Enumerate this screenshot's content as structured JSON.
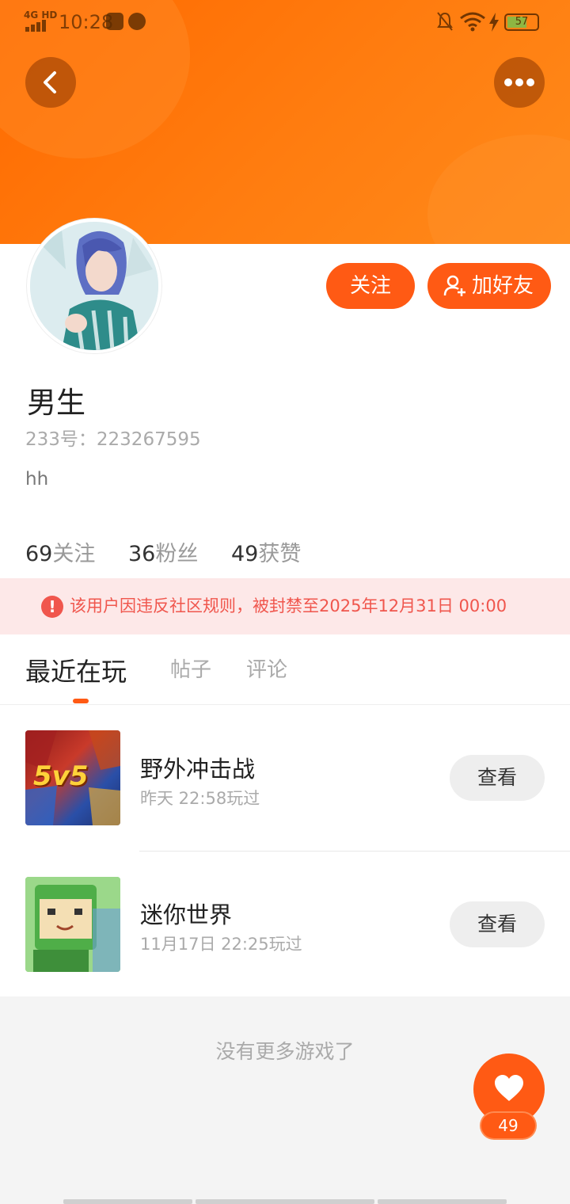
{
  "status_bar": {
    "network": "4G HD",
    "time": "10:28",
    "battery": "57"
  },
  "profile": {
    "name": "男生",
    "uid_label": "233号：",
    "uid": "223267595",
    "bio": "hh",
    "follow_label": "关注",
    "add_friend_label": "加好友",
    "stats": [
      {
        "value": "69",
        "label": "关注"
      },
      {
        "value": "36",
        "label": "粉丝"
      },
      {
        "value": "49",
        "label": "获赞"
      }
    ]
  },
  "ban_notice": "该用户因违反社区规则，被封禁至2025年12月31日 00:00",
  "tabs": [
    {
      "label": "最近在玩",
      "active": true
    },
    {
      "label": "帖子",
      "active": false
    },
    {
      "label": "评论",
      "active": false
    }
  ],
  "games": [
    {
      "name": "野外冲击战",
      "time": "昨天 22:58玩过",
      "button": "查看",
      "thumb_text": "5v5"
    },
    {
      "name": "迷你世界",
      "time": "11月17日 22:25玩过",
      "button": "查看",
      "thumb_text": ""
    }
  ],
  "end_text": "没有更多游戏了",
  "like_count": "49",
  "colors": {
    "accent": "#ff5a14",
    "header": "#ff7a10",
    "ban_bg": "#fde8e8",
    "ban_text": "#f0564d"
  }
}
